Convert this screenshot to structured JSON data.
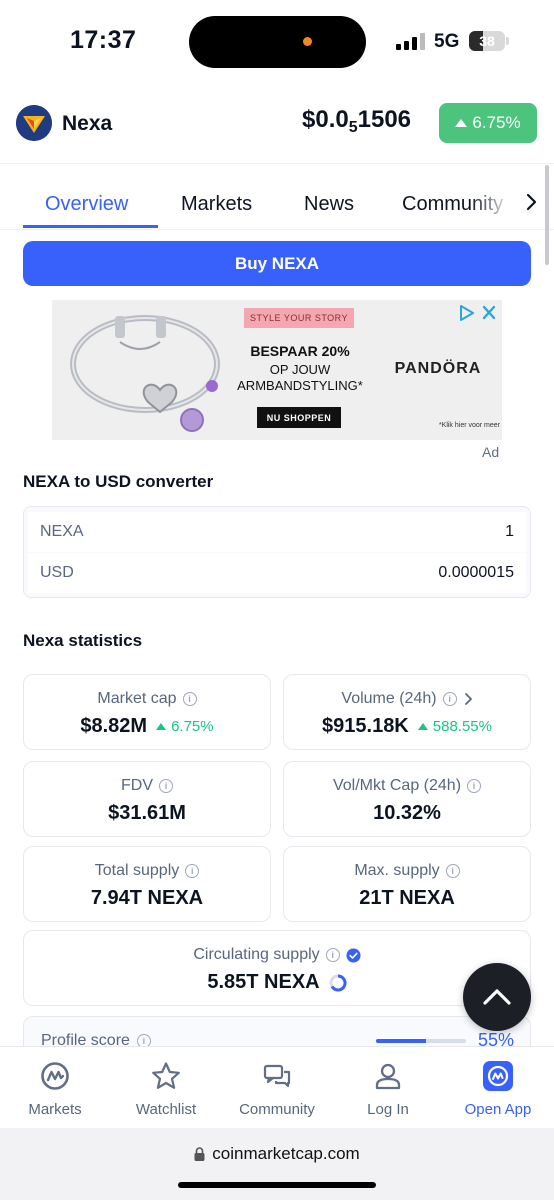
{
  "status_bar": {
    "time": "17:37",
    "network": "5G",
    "battery": "38",
    "battery_level": 0.38
  },
  "coin": {
    "name": "Nexa",
    "price_main": "$0.0",
    "price_sub": "5",
    "price_tail": "1506",
    "change": "6.75%",
    "change_color": "#4dc47d"
  },
  "tabs": [
    {
      "label": "Overview",
      "active": true
    },
    {
      "label": "Markets"
    },
    {
      "label": "News"
    },
    {
      "label": "Community"
    }
  ],
  "buy_button": {
    "label": "Buy NEXA"
  },
  "ad": {
    "tag": "STYLE YOUR STORY",
    "headline": "BESPAAR 20%",
    "line1": "OP JOUW",
    "line2": "ARMBANDSTYLING*",
    "cta": "NU SHOPPEN",
    "brand": "PANDÖRA",
    "note": "*Klik hier voor meer",
    "label": "Ad"
  },
  "converter": {
    "title": "NEXA to USD converter",
    "from_label": "NEXA",
    "from_value": "1",
    "to_label": "USD",
    "to_value": "0.0000015"
  },
  "statistics": {
    "title": "Nexa statistics",
    "market_cap": {
      "label": "Market cap",
      "value": "$8.82M",
      "change": "6.75%"
    },
    "volume": {
      "label": "Volume (24h)",
      "value": "$915.18K",
      "change": "588.55%"
    },
    "fdv": {
      "label": "FDV",
      "value": "$31.61M"
    },
    "vol_mkt_cap": {
      "label": "Vol/Mkt Cap (24h)",
      "value": "10.32%"
    },
    "total_supply": {
      "label": "Total supply",
      "value": "7.94T NEXA"
    },
    "max_supply": {
      "label": "Max. supply",
      "value": "21T NEXA"
    },
    "circulating_supply": {
      "label": "Circulating supply",
      "value": "5.85T NEXA"
    }
  },
  "profile_score": {
    "label": "Profile score",
    "value": "55%",
    "fraction": 0.55
  },
  "bottom_nav": [
    {
      "label": "Markets",
      "icon": "markets-logo-icon"
    },
    {
      "label": "Watchlist",
      "icon": "star-icon"
    },
    {
      "label": "Community",
      "icon": "chat-bubbles-icon"
    },
    {
      "label": "Log In",
      "icon": "user-icon"
    },
    {
      "label": "Open App",
      "icon": "app-icon"
    }
  ],
  "url_bar": {
    "url": "coinmarketcap.com"
  },
  "colors": {
    "accent": "#3861fb",
    "positive": "#16c784",
    "text": "#0d1421",
    "muted": "#58667e"
  }
}
